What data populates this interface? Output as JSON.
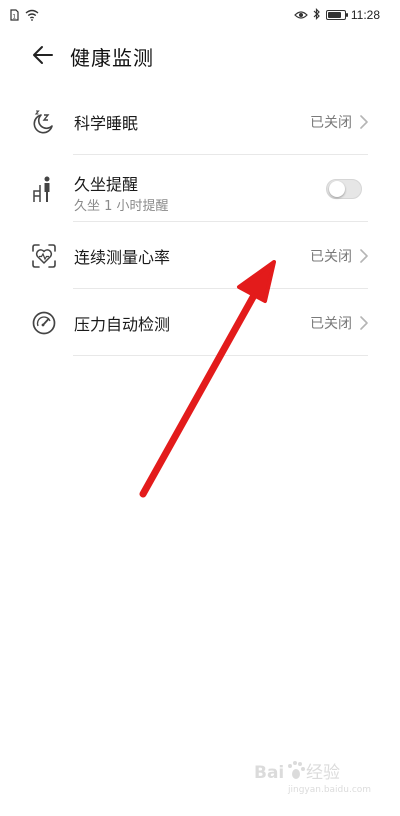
{
  "status_bar": {
    "time": "11:28",
    "battery_level": 0.8,
    "icons": [
      "sim-icon",
      "wifi-icon",
      "eye-icon",
      "bluetooth-icon",
      "battery-icon"
    ]
  },
  "header": {
    "title": "健康监测",
    "back_icon": "back-arrow-icon"
  },
  "items": [
    {
      "icon": "sleep-icon",
      "title": "科学睡眠",
      "status": "已关闭",
      "control": "chevron"
    },
    {
      "icon": "sedentary-icon",
      "title": "久坐提醒",
      "subtitle": "久坐 1 小时提醒",
      "control": "toggle",
      "toggle_on": false
    },
    {
      "icon": "heart-rate-icon",
      "title": "连续测量心率",
      "status": "已关闭",
      "control": "chevron"
    },
    {
      "icon": "pressure-gauge-icon",
      "title": "压力自动检测",
      "status": "已关闭",
      "control": "chevron"
    }
  ],
  "annotation": {
    "type": "arrow",
    "color": "#e31b1b",
    "points_to": "连续测量心率"
  },
  "watermark": {
    "text": "Baidu经验",
    "url_text": "jingyan.baidu.com"
  }
}
